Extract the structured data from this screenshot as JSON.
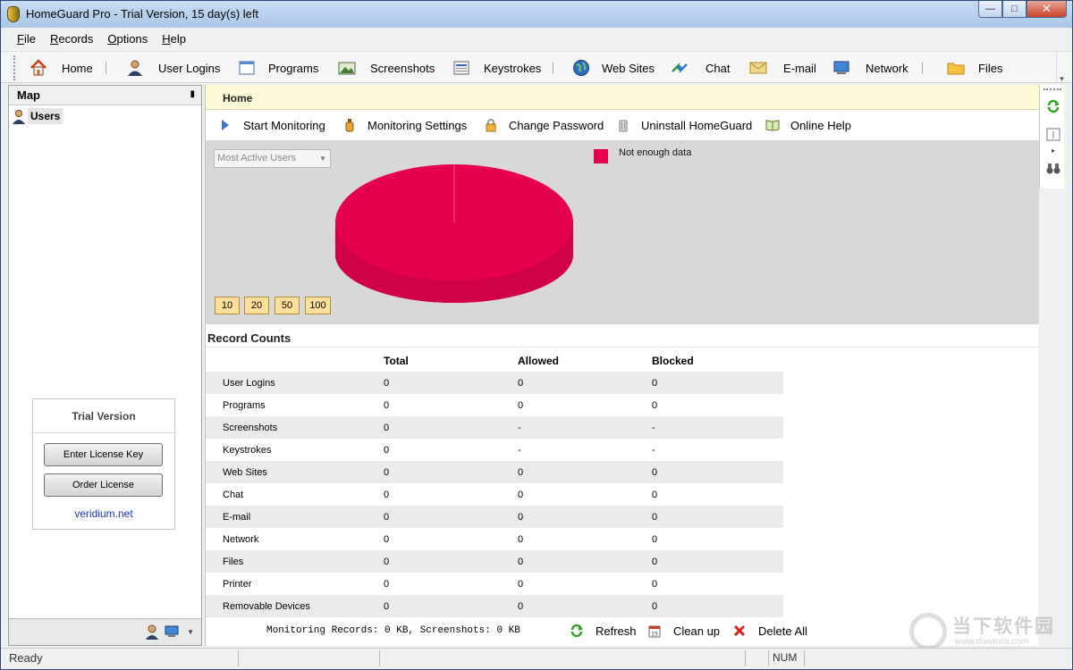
{
  "window": {
    "title": "HomeGuard Pro - Trial Version, 15 day(s) left"
  },
  "menu": [
    {
      "u": "F",
      "rest": "ile"
    },
    {
      "u": "R",
      "rest": "ecords"
    },
    {
      "u": "O",
      "rest": "ptions"
    },
    {
      "u": "H",
      "rest": "elp"
    }
  ],
  "toolbar": {
    "home": "Home",
    "user_logins": "User Logins",
    "programs": "Programs",
    "screenshots": "Screenshots",
    "keystrokes": "Keystrokes",
    "web_sites": "Web Sites",
    "chat": "Chat",
    "email": "E-mail",
    "network": "Network",
    "files": "Files"
  },
  "map": {
    "title": "Map",
    "users_label": "Users",
    "trial": {
      "title": "Trial Version",
      "enter_key": "Enter License Key",
      "order": "Order License",
      "link": "veridium.net"
    }
  },
  "main": {
    "header": "Home",
    "actions": {
      "start": "Start Monitoring",
      "settings": "Monitoring Settings",
      "password": "Change Password",
      "uninstall": "Uninstall HomeGuard",
      "help": "Online Help"
    },
    "combo_value": "Most Active Users",
    "legend": "Not enough data",
    "top_buttons": [
      "10",
      "20",
      "50",
      "100"
    ],
    "record_counts_title": "Record Counts",
    "columns": [
      "",
      "Total",
      "Allowed",
      "Blocked"
    ],
    "rows": [
      [
        "User Logins",
        "0",
        "0",
        "0"
      ],
      [
        "Programs",
        "0",
        "0",
        "0"
      ],
      [
        "Screenshots",
        "0",
        "-",
        "-"
      ],
      [
        "Keystrokes",
        "0",
        "-",
        "-"
      ],
      [
        "Web Sites",
        "0",
        "0",
        "0"
      ],
      [
        "Chat",
        "0",
        "0",
        "0"
      ],
      [
        "E-mail",
        "0",
        "0",
        "0"
      ],
      [
        "Network",
        "0",
        "0",
        "0"
      ],
      [
        "Files",
        "0",
        "0",
        "0"
      ],
      [
        "Printer",
        "0",
        "0",
        "0"
      ],
      [
        "Removable Devices",
        "0",
        "0",
        "0"
      ]
    ],
    "monitoring_text": "Monitoring Records: 0 KB, Screenshots: 0 KB",
    "bottom_actions": {
      "refresh": "Refresh",
      "cleanup": "Clean up",
      "delete_all": "Delete All"
    }
  },
  "status": {
    "left": "Ready",
    "num": "NUM"
  },
  "watermark": {
    "text": "当下软件园",
    "sub": "www.downxia.com"
  },
  "colors": {
    "pie": "#e6004c",
    "header_bg": "#fcf9d6",
    "chart_bg": "#d8d8d8",
    "link": "#1a39b8"
  }
}
